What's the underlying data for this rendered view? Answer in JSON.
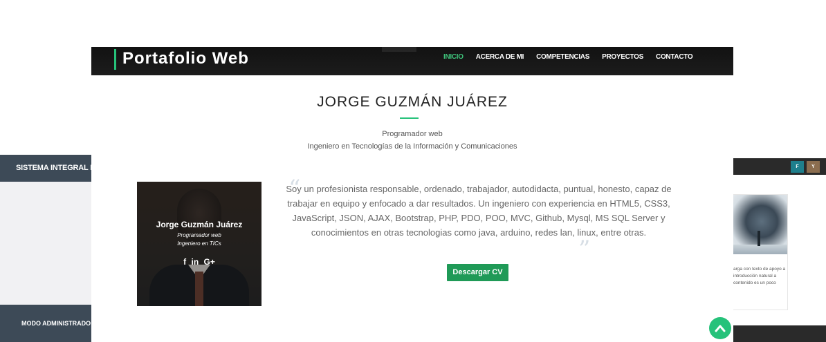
{
  "background_left": {
    "header": "SISTEMA INTEGRAL D",
    "footer": "MODO ADMINISTRADO"
  },
  "background_right": {
    "buttons": [
      "F",
      "Y"
    ],
    "text": "arga con texto de apoyo a introducción natural a contenido es un poco"
  },
  "navbar": {
    "brand": "Portafolio Web",
    "items": [
      "INICIO",
      "ACERCA DE MI",
      "COMPETENCIAS",
      "PROYECTOS",
      "CONTACTO"
    ],
    "active_index": 0
  },
  "profile": {
    "name_title": "JORGE GUZMÁN JUÁREZ",
    "role": "Programador web",
    "degree": "Ingeniero en Tecnologías de la Información y Comunicaciones",
    "card_name": "Jorge Guzmán Juárez",
    "card_role": "Programador web",
    "card_degree": "Ingeniero en TICs",
    "social": [
      "f",
      "in",
      "G+"
    ],
    "bio": "Soy un profesionista responsable, ordenado, trabajador, autodidacta, puntual, honesto, capaz de trabajar en equipo y enfocado a dar resultados. Un ingeniero con experiencia en HTML5, CSS3, JavaScript, JSON, AJAX, Bootstrap, PHP, PDO, POO, MVC, Github, Mysql, MS SQL Server y conocimientos en otras tecnologias como java, arduino, redes lan, linux, entre otras.",
    "cv_button": "Descargar CV"
  },
  "colors": {
    "accent": "#26c27a",
    "button": "#1f9a57",
    "navbar": "#161616"
  },
  "icons": {
    "scroll_top": "chevron-up-icon",
    "quote": "quote-icon"
  }
}
